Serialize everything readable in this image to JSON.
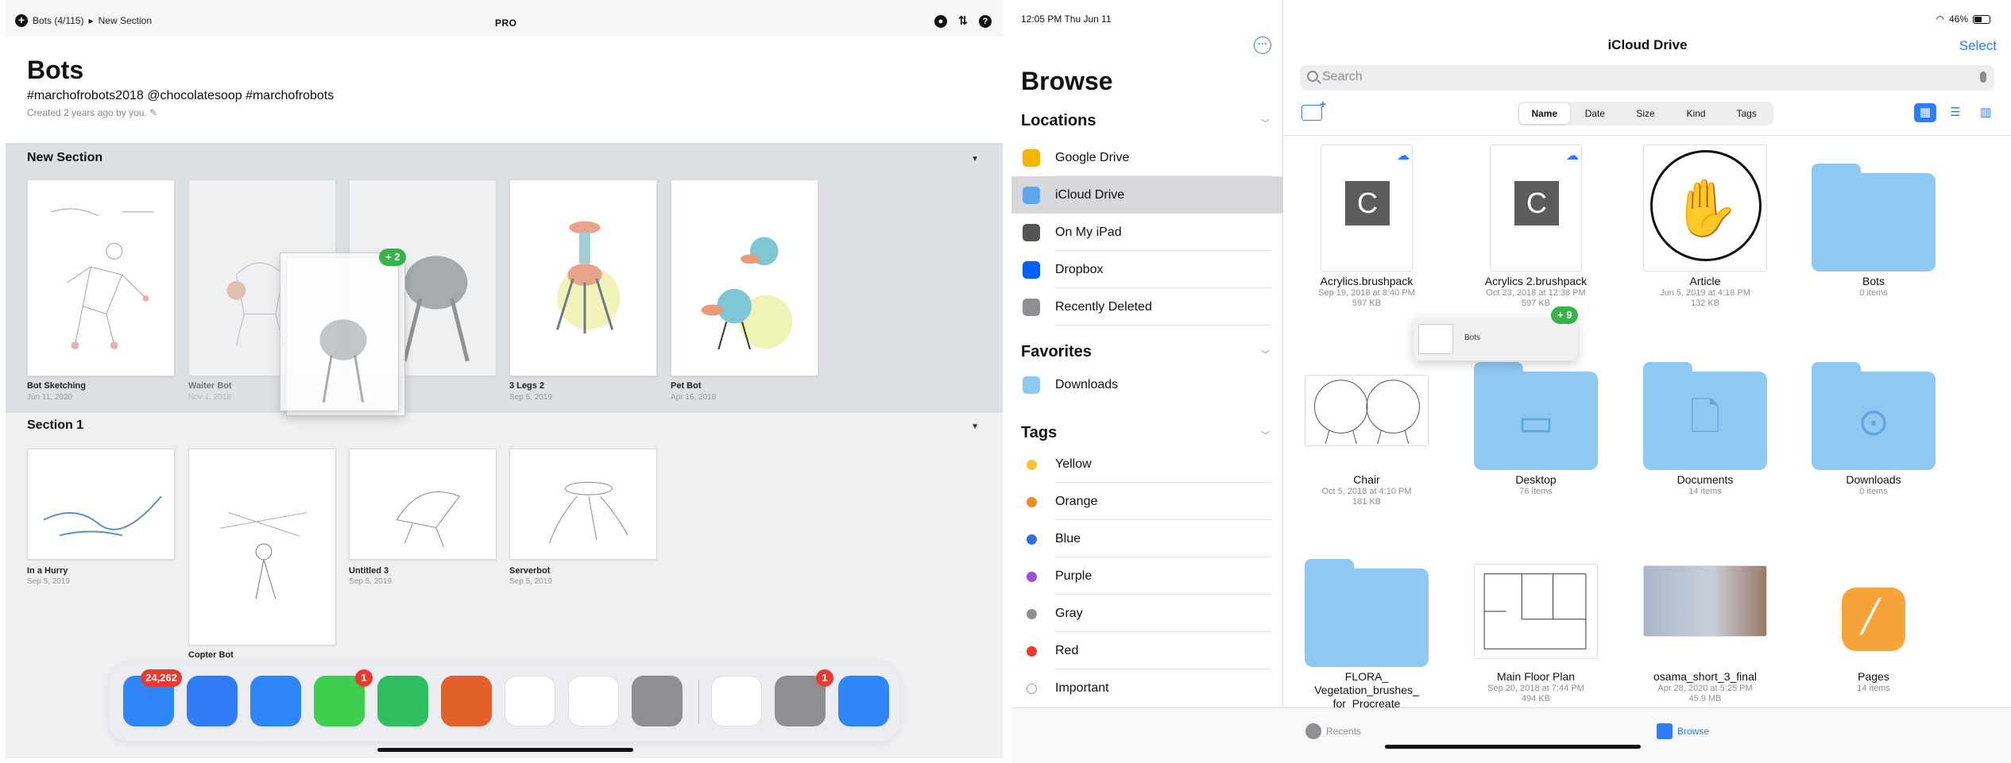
{
  "left": {
    "status": {
      "breadcrumb_stack": "Bots (4/115)",
      "breadcrumb_section": "New Section",
      "pro_label": "PRO",
      "help_icon": "?"
    },
    "header": {
      "title": "Bots",
      "tags": "#marchofrobots2018 @chocolatesoop #marchofrobots",
      "created": "Created 2 years ago by you."
    },
    "sections": [
      {
        "label": "New Section",
        "items": [
          {
            "name": "Bot Sketching",
            "date": "Jun 11, 2020"
          },
          {
            "name": "Waiter Bot",
            "date": "Nov 1, 2018"
          },
          {
            "name": "",
            "date": ""
          },
          {
            "name": "3 Legs 2",
            "date": "Sep 5, 2019"
          },
          {
            "name": "Pet Bot",
            "date": "Apr 16, 2018"
          }
        ]
      },
      {
        "label": "Section 1",
        "items": [
          {
            "name": "In a Hurry",
            "date": "Sep 5, 2019"
          },
          {
            "name": "Copter Bot",
            "date": ""
          },
          {
            "name": "Untitled 3",
            "date": "Sep 5, 2019"
          },
          {
            "name": "Serverbot",
            "date": "Sep 5, 2019"
          }
        ]
      }
    ],
    "drag_badge": "+ 2",
    "dock": {
      "apps": [
        {
          "name": "Mail",
          "icon": "mail-icon",
          "badge": "24,262",
          "color": "#2f86f6"
        },
        {
          "name": "Files",
          "icon": "files-icon",
          "badge": "",
          "color": "#2f7cf6"
        },
        {
          "name": "Safari",
          "icon": "safari-icon",
          "badge": "",
          "color": "#2f86f6"
        },
        {
          "name": "Messages",
          "icon": "messages-icon",
          "badge": "1",
          "color": "#3fcf4e"
        },
        {
          "name": "Evernote",
          "icon": "evernote-icon",
          "badge": "",
          "color": "#2dbe60"
        },
        {
          "name": "Procreate",
          "icon": "procreate-icon",
          "badge": "",
          "color": "#e2612a"
        },
        {
          "name": "Slack",
          "icon": "slack-icon",
          "badge": "",
          "color": "#ffffff"
        },
        {
          "name": "Photos",
          "icon": "photos-icon",
          "badge": "",
          "color": "#ffffff"
        },
        {
          "name": "Camera",
          "icon": "camera-icon",
          "badge": "",
          "color": "#8e8e93"
        },
        {
          "name": "Color",
          "icon": "color-wheel-icon",
          "badge": "",
          "color": "#ffffff"
        },
        {
          "name": "Settings",
          "icon": "settings-icon",
          "badge": "1",
          "color": "#8e8e93"
        },
        {
          "name": "Safari",
          "icon": "safari-icon",
          "badge": "",
          "color": "#2f86f6"
        }
      ]
    }
  },
  "sidebar": {
    "time": "12:05 PM  Thu Jun 11",
    "title": "Browse",
    "locations_header": "Locations",
    "locations": [
      {
        "label": "Google Drive",
        "icon": "google-drive-icon",
        "color": "#f4b400"
      },
      {
        "label": "iCloud Drive",
        "icon": "icloud-icon",
        "color": "#5aa9ef",
        "selected": true
      },
      {
        "label": "On My iPad",
        "icon": "ipad-icon",
        "color": "#555555"
      },
      {
        "label": "Dropbox",
        "icon": "dropbox-icon",
        "color": "#0061fe"
      },
      {
        "label": "Recently Deleted",
        "icon": "trash-icon",
        "color": "#8e8e93"
      }
    ],
    "favorites_header": "Favorites",
    "favorites": [
      {
        "label": "Downloads",
        "icon": "folder-icon",
        "color": "#8fc9f2"
      }
    ],
    "tags_header": "Tags",
    "tags": [
      {
        "label": "Yellow",
        "color": "#f7c331"
      },
      {
        "label": "Orange",
        "color": "#f08a24"
      },
      {
        "label": "Blue",
        "color": "#2f6fe0"
      },
      {
        "label": "Purple",
        "color": "#a04fd2"
      },
      {
        "label": "Gray",
        "color": "#8e8e93"
      },
      {
        "label": "Red",
        "color": "#e53b30"
      },
      {
        "label": "Important",
        "color": "#ffffff"
      }
    ]
  },
  "main": {
    "battery": "46%",
    "title": "iCloud Drive",
    "select_label": "Select",
    "search_placeholder": "Search",
    "sort_options": [
      "Name",
      "Date",
      "Size",
      "Kind",
      "Tags"
    ],
    "sort_active": "Name",
    "items": [
      {
        "name": "Acrylics.brushpack",
        "sub1": "Sep 19, 2018 at 8:40 PM",
        "sub2": "597 KB",
        "kind": "brushpack",
        "cloud": true
      },
      {
        "name": "Acrylics 2.brushpack",
        "sub1": "Oct 23, 2018 at 12:38 PM",
        "sub2": "597 KB",
        "kind": "brushpack",
        "cloud": true
      },
      {
        "name": "Article",
        "sub1": "Jun 5, 2019 at 4:18 PM",
        "sub2": "132 KB",
        "kind": "hand"
      },
      {
        "name": "Bots",
        "sub1": "0 items",
        "sub2": "",
        "kind": "folder"
      },
      {
        "name": "Chair",
        "sub1": "Oct 5, 2018 at 4:10 PM",
        "sub2": "181 KB",
        "kind": "chair"
      },
      {
        "name": "Desktop",
        "sub1": "76 items",
        "sub2": "",
        "kind": "folder",
        "glyph": "▭"
      },
      {
        "name": "Documents",
        "sub1": "14 items",
        "sub2": "",
        "kind": "folder",
        "glyph": "🗋"
      },
      {
        "name": "Downloads",
        "sub1": "0 items",
        "sub2": "",
        "kind": "folder",
        "glyph": "⊙"
      },
      {
        "name": "FLORA_ Vegetation_brushes_ for_Procreate",
        "sub1": "5 items",
        "sub2": "",
        "kind": "folder"
      },
      {
        "name": "Main Floor Plan",
        "sub1": "Sep 20, 2018 at 7:44 PM",
        "sub2": "494 KB",
        "kind": "plan"
      },
      {
        "name": "osama_short_3_final",
        "sub1": "Apr 28, 2020 at 5:25 PM",
        "sub2": "45.9 MB",
        "kind": "photo"
      },
      {
        "name": "Pages",
        "sub1": "14 items",
        "sub2": "",
        "kind": "pages"
      }
    ],
    "drag_label": "Bots",
    "drag_badge": "+ 9"
  },
  "tabbar": {
    "recents": "Recents",
    "browse": "Browse"
  }
}
